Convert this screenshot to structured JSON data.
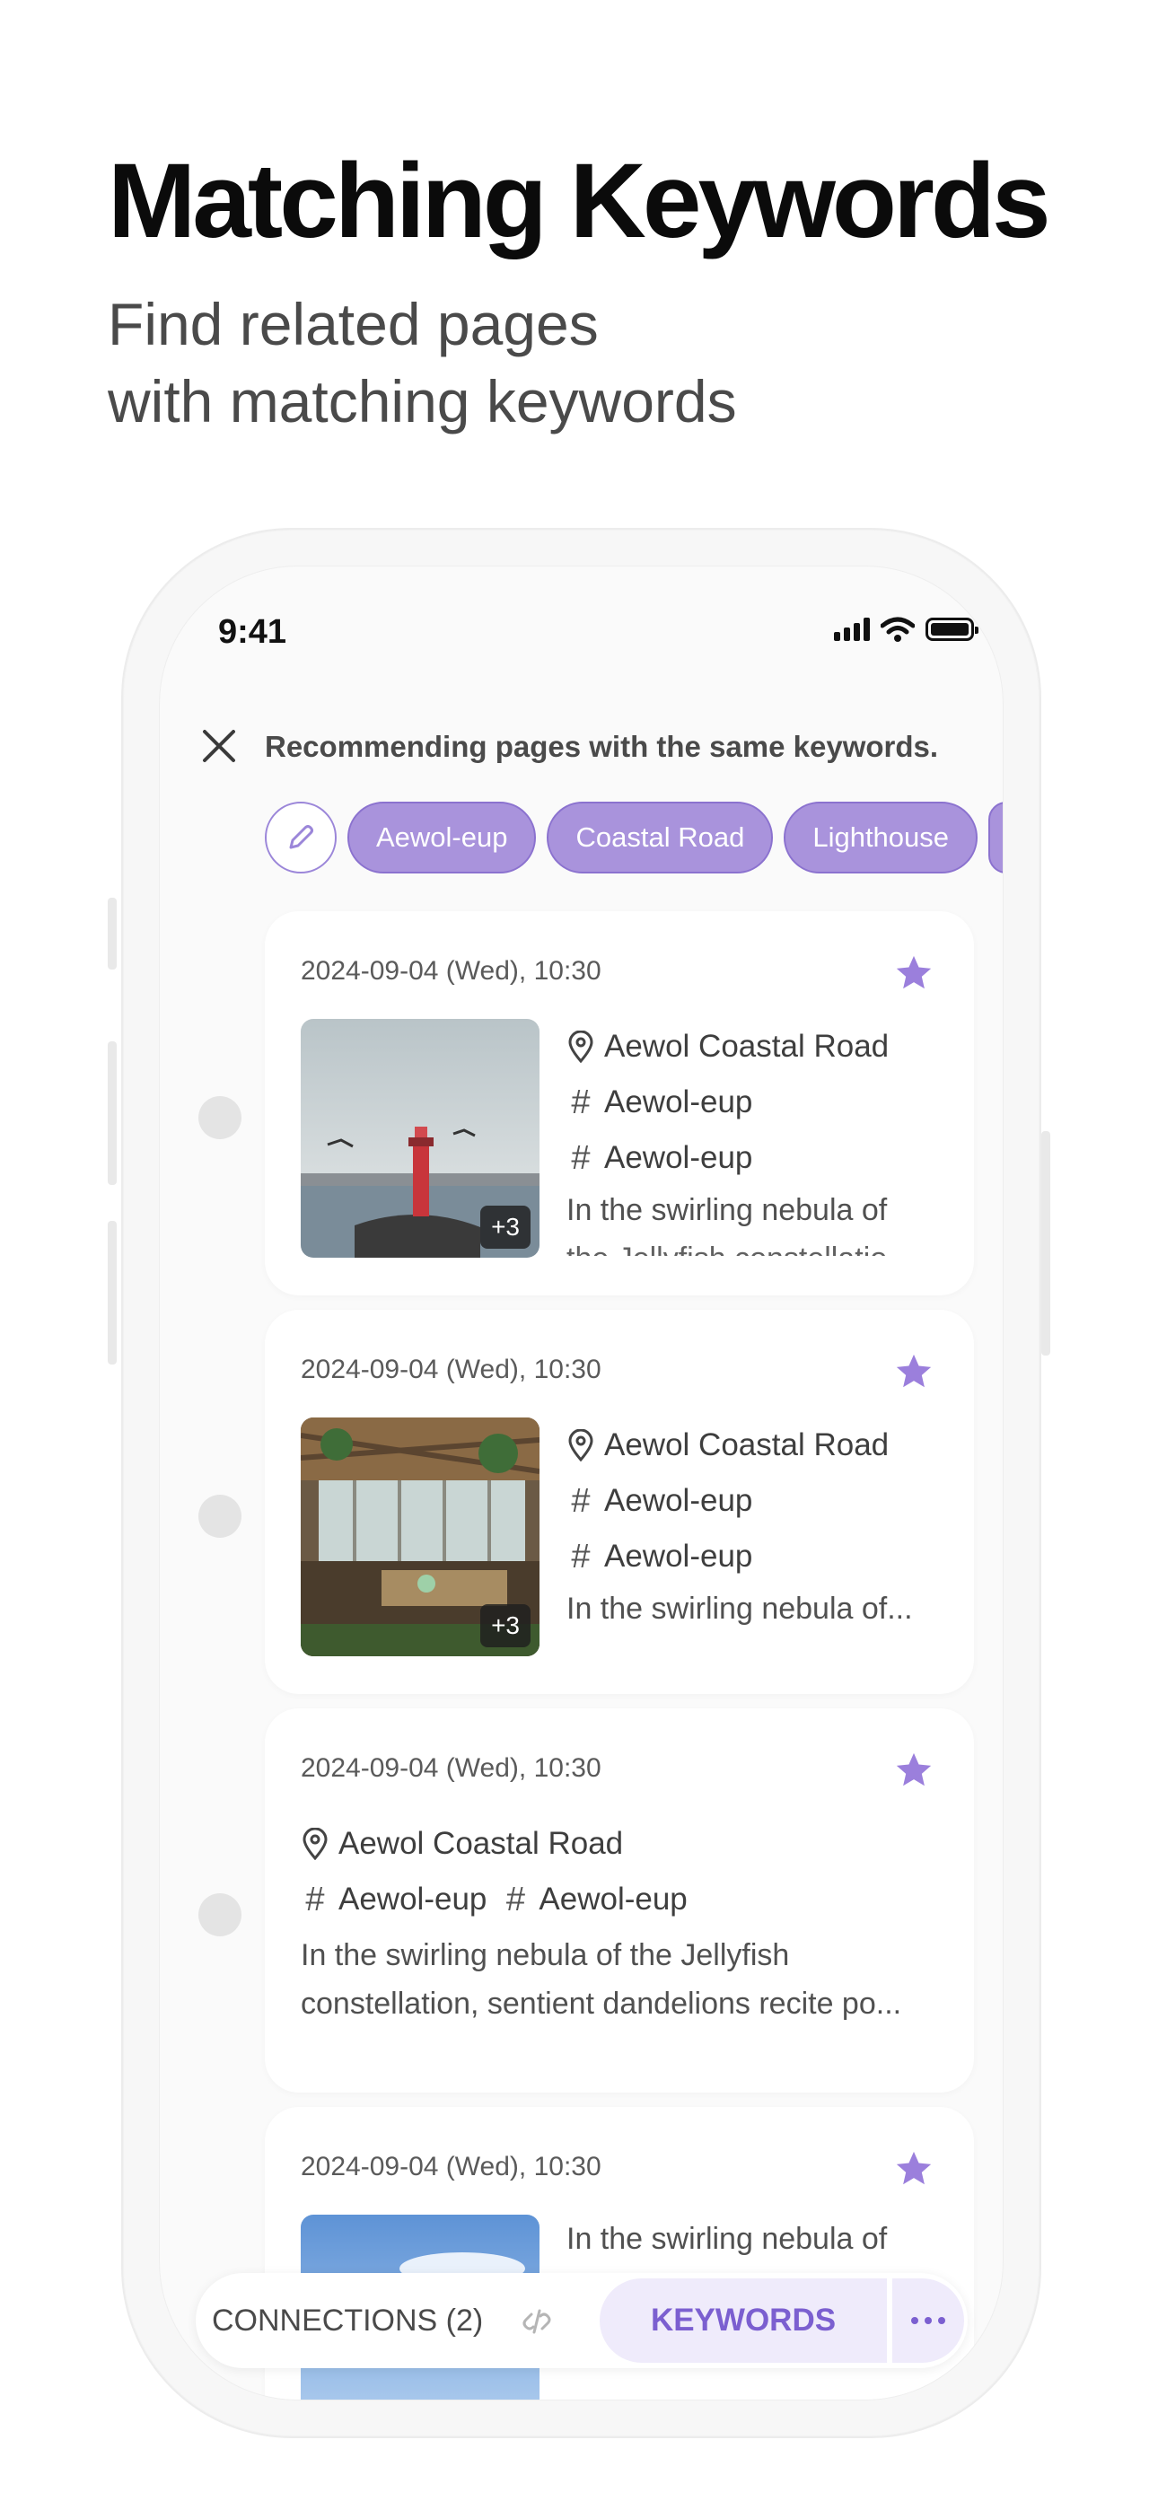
{
  "marketing": {
    "headline": "Matching Keywords",
    "subline_1": "Find related pages",
    "subline_2": "with matching keywords"
  },
  "status_bar": {
    "time": "9:41"
  },
  "topbar": {
    "title": "Recommending pages with the same keywords."
  },
  "keyword_chips": [
    "Aewol-eup",
    "Coastal Road",
    "Lighthouse"
  ],
  "cards": [
    {
      "date": "2024-09-04 (Wed), 10:30",
      "location": "Aewol Coastal Road",
      "tags": [
        "Aewol-eup",
        "Aewol-eup"
      ],
      "photo_badge": "+3",
      "snippet_1": "In the swirling nebula of",
      "snippet_2": "the Jellyfish constellatio"
    },
    {
      "date": "2024-09-04 (Wed), 10:30",
      "location": "Aewol Coastal Road",
      "tags": [
        "Aewol-eup",
        "Aewol-eup"
      ],
      "photo_badge": "+3",
      "snippet_1": "In the swirling nebula of..."
    },
    {
      "date": "2024-09-04 (Wed), 10:30",
      "location": "Aewol Coastal Road",
      "tags": [
        "Aewol-eup",
        "Aewol-eup"
      ],
      "snippet_1": "In the swirling nebula of the Jellyfish",
      "snippet_2": "constellation, sentient dandelions recite po..."
    },
    {
      "date": "2024-09-04 (Wed), 10:30",
      "snippet_1": "In the swirling nebula of"
    }
  ],
  "bottom_bar": {
    "connections_label": "CONNECTIONS (2)",
    "keywords_label": "KEYWORDS"
  },
  "colors": {
    "accent": "#a993dc",
    "accent_dark": "#7b5fd0",
    "accent_light": "#efebfb",
    "star": "#9b7fdc"
  }
}
